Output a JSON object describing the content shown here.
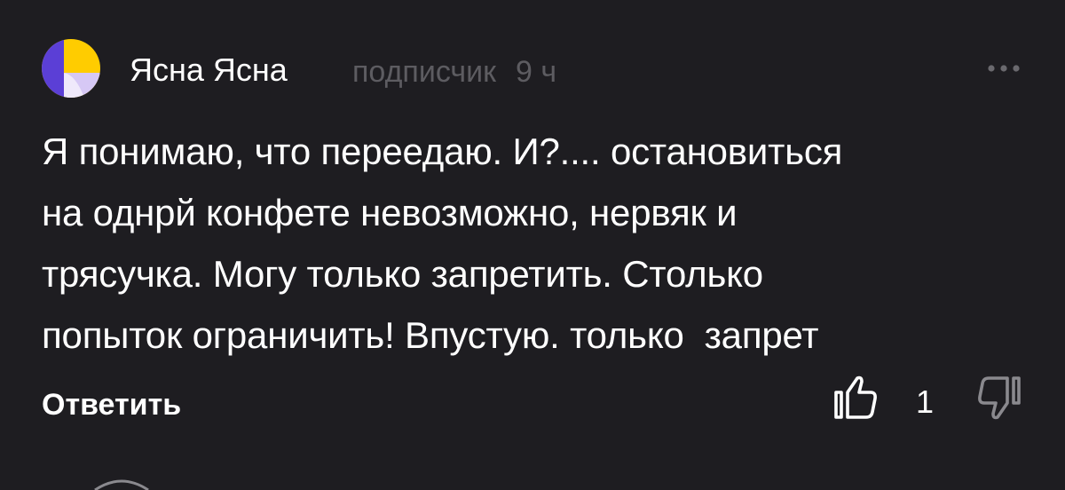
{
  "comment": {
    "author": {
      "name": "Ясна Ясна",
      "role": "подписчик",
      "time": "9 ч",
      "avatar_icon": "yellow-white-avatar-icon"
    },
    "text_lines": [
      "Я понимаю, что переедаю. И?.... остановиться",
      "на однрй конфете невозможно, нервяк и",
      "трясучка. Могу только запретить. Столько",
      "попыток ограничить! Впустую. только  запрет"
    ],
    "more_icon": "more-dots-icon",
    "actions": {
      "reply_label": "Ответить",
      "like_icon": "thumbs-up-icon",
      "like_count": "1",
      "dislike_icon": "thumbs-down-icon"
    }
  },
  "colors": {
    "background": "#1e1d21",
    "text": "#ffffff",
    "muted": "#5d5c61",
    "avatar_yellow": "#ffcc00",
    "avatar_purple": "#5b3fd6",
    "avatar_lavender": "#d6c8f5"
  }
}
